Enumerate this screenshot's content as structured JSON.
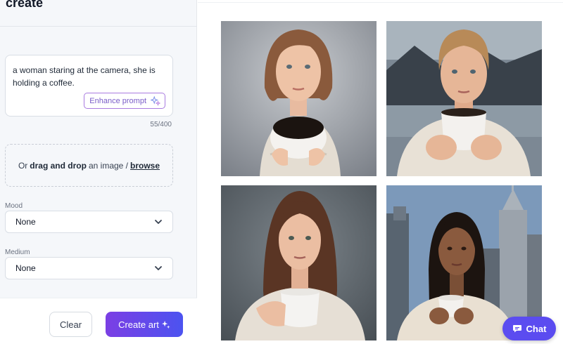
{
  "header": {
    "title": "create"
  },
  "prompt": {
    "text": "a woman staring at the camera, she is holding a coffee.",
    "enhance_label": "Enhance prompt",
    "char_count": "55/400"
  },
  "upload": {
    "prefix": "Or",
    "drag_text": "drag and drop",
    "middle": "an image /",
    "browse_label": "browse"
  },
  "mood": {
    "label": "Mood",
    "value": "None"
  },
  "medium": {
    "label": "Medium",
    "value": "None"
  },
  "actions": {
    "clear_label": "Clear",
    "create_label": "Create art"
  },
  "chat": {
    "label": "Chat"
  },
  "gallery": {
    "images": [
      {
        "alt": "woman with bob hair holding coffee cup",
        "icon": "generated-image"
      },
      {
        "alt": "woman with updo holding coffee mug by lake",
        "icon": "generated-image"
      },
      {
        "alt": "woman with long brown hair holding white mug",
        "icon": "generated-image"
      },
      {
        "alt": "woman holding cup in city",
        "icon": "generated-image"
      }
    ]
  },
  "colors": {
    "accent": "#5b4cf0",
    "create_gradient_start": "#7b3fe4",
    "create_gradient_end": "#4c53f0",
    "enhance_border": "#a97be0"
  }
}
